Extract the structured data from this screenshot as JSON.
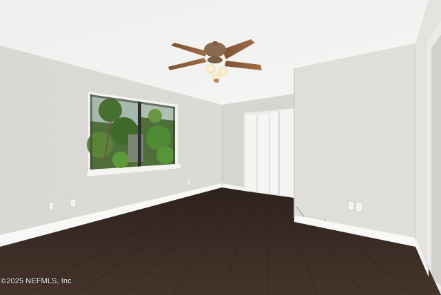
{
  "photo": {
    "watermark": "©2025 NEFMLS, Inc",
    "colors": {
      "ceiling": "#f1f1ef",
      "left_wall": "#dddcd8",
      "back_wall": "#d7d7d2",
      "right_wall": "#e1e0dc",
      "floor": "#3b2c25",
      "baseboard": "#f7f7f5",
      "fan_blades": "#8d5f3d",
      "foliage": "#3f6e2a",
      "door": "#f4f4f2"
    }
  }
}
